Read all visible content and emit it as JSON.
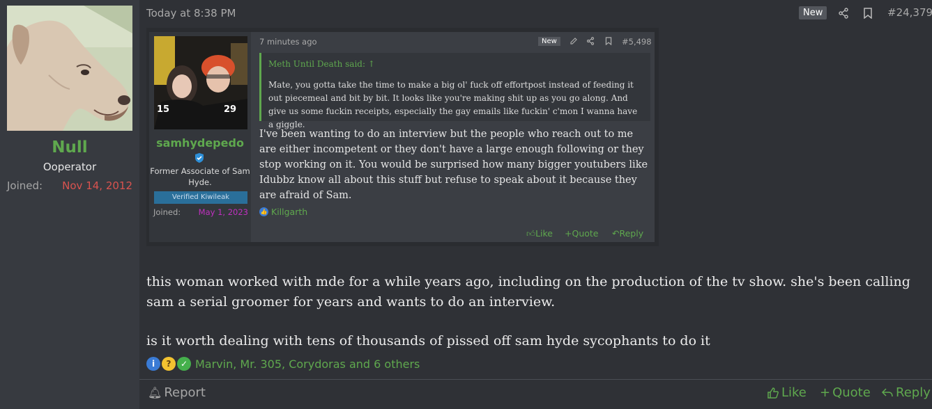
{
  "author": {
    "name": "Null",
    "title": "Ooperator",
    "joined_label": "Joined:",
    "joined_date": "Nov 14, 2012",
    "name_color": "#5fa84e"
  },
  "post": {
    "timestamp": "Today at 8:38 PM",
    "new_badge": "New",
    "post_number": "#24,379",
    "icons": [
      "share-icon",
      "bookmark-icon"
    ],
    "paragraphs": [
      "this woman worked with mde for a while years ago, including on the production of the tv show. she's been calling sam a serial groomer for years and wants to do an interview.",
      "is it worth dealing with tens of thousands of pissed off sam hyde sycophants to do it"
    ],
    "reactions": {
      "icons": [
        "info-icon",
        "thinking-icon",
        "check-icon"
      ],
      "names": "Marvin, Mr. 305, Corydoras and 6 others"
    },
    "footer": {
      "report": "Report",
      "like": "Like",
      "quote": "Quote",
      "reply": "Reply"
    }
  },
  "embedded": {
    "user": {
      "name": "samhydepedo",
      "title": "Former Associate of Sam Hyde.",
      "verified": "Verified Kiwileak",
      "joined_label": "Joined:",
      "joined_date": "May 1, 2023",
      "photo_numbers": [
        "15",
        "29"
      ]
    },
    "time": "7 minutes ago",
    "new_badge": "New",
    "post_number": "#5,498",
    "quote": {
      "author": "Meth Until Death said:",
      "text": "Mate, you gotta take the time to make a big ol' fuck off effortpost instead of feeding it out piecemeal and bit by bit. It looks like you're making shit up as you go along. And give us some fuckin receipts, especially the gay emails like fuckin' c'mon I wanna have a giggle."
    },
    "body": "I've been wanting to do an interview but the people who reach out to me are either incompetent or they don't have a large enough following or they stop working on it. You would be surprised how many bigger youtubers like Idubbz know all about this stuff but refuse to speak about it because they are afraid of Sam.",
    "reaction_name": "Killgarth",
    "actions": {
      "like": "Like",
      "quote": "+Quote",
      "reply": "Reply"
    }
  }
}
